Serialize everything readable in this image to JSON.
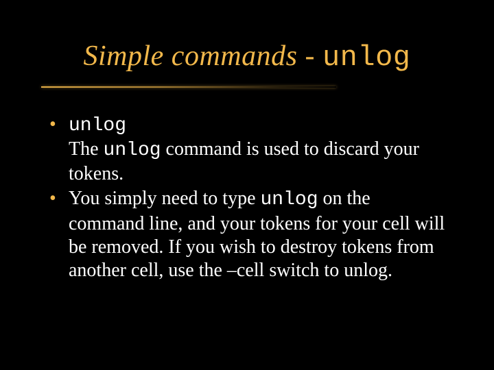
{
  "title": {
    "prefix": "Simple commands - ",
    "keyword": "unlog"
  },
  "bullets": [
    {
      "head_mono": "unlog",
      "rest_before": "The ",
      "rest_mono": "unlog",
      "rest_after": " command is used to discard your tokens."
    },
    {
      "text_before": "You simply need to type ",
      "text_mono": "unlog",
      "text_after": " on the command line, and your tokens for your cell will be removed.  If you wish to destroy tokens from another cell, use the –cell switch to unlog."
    }
  ]
}
